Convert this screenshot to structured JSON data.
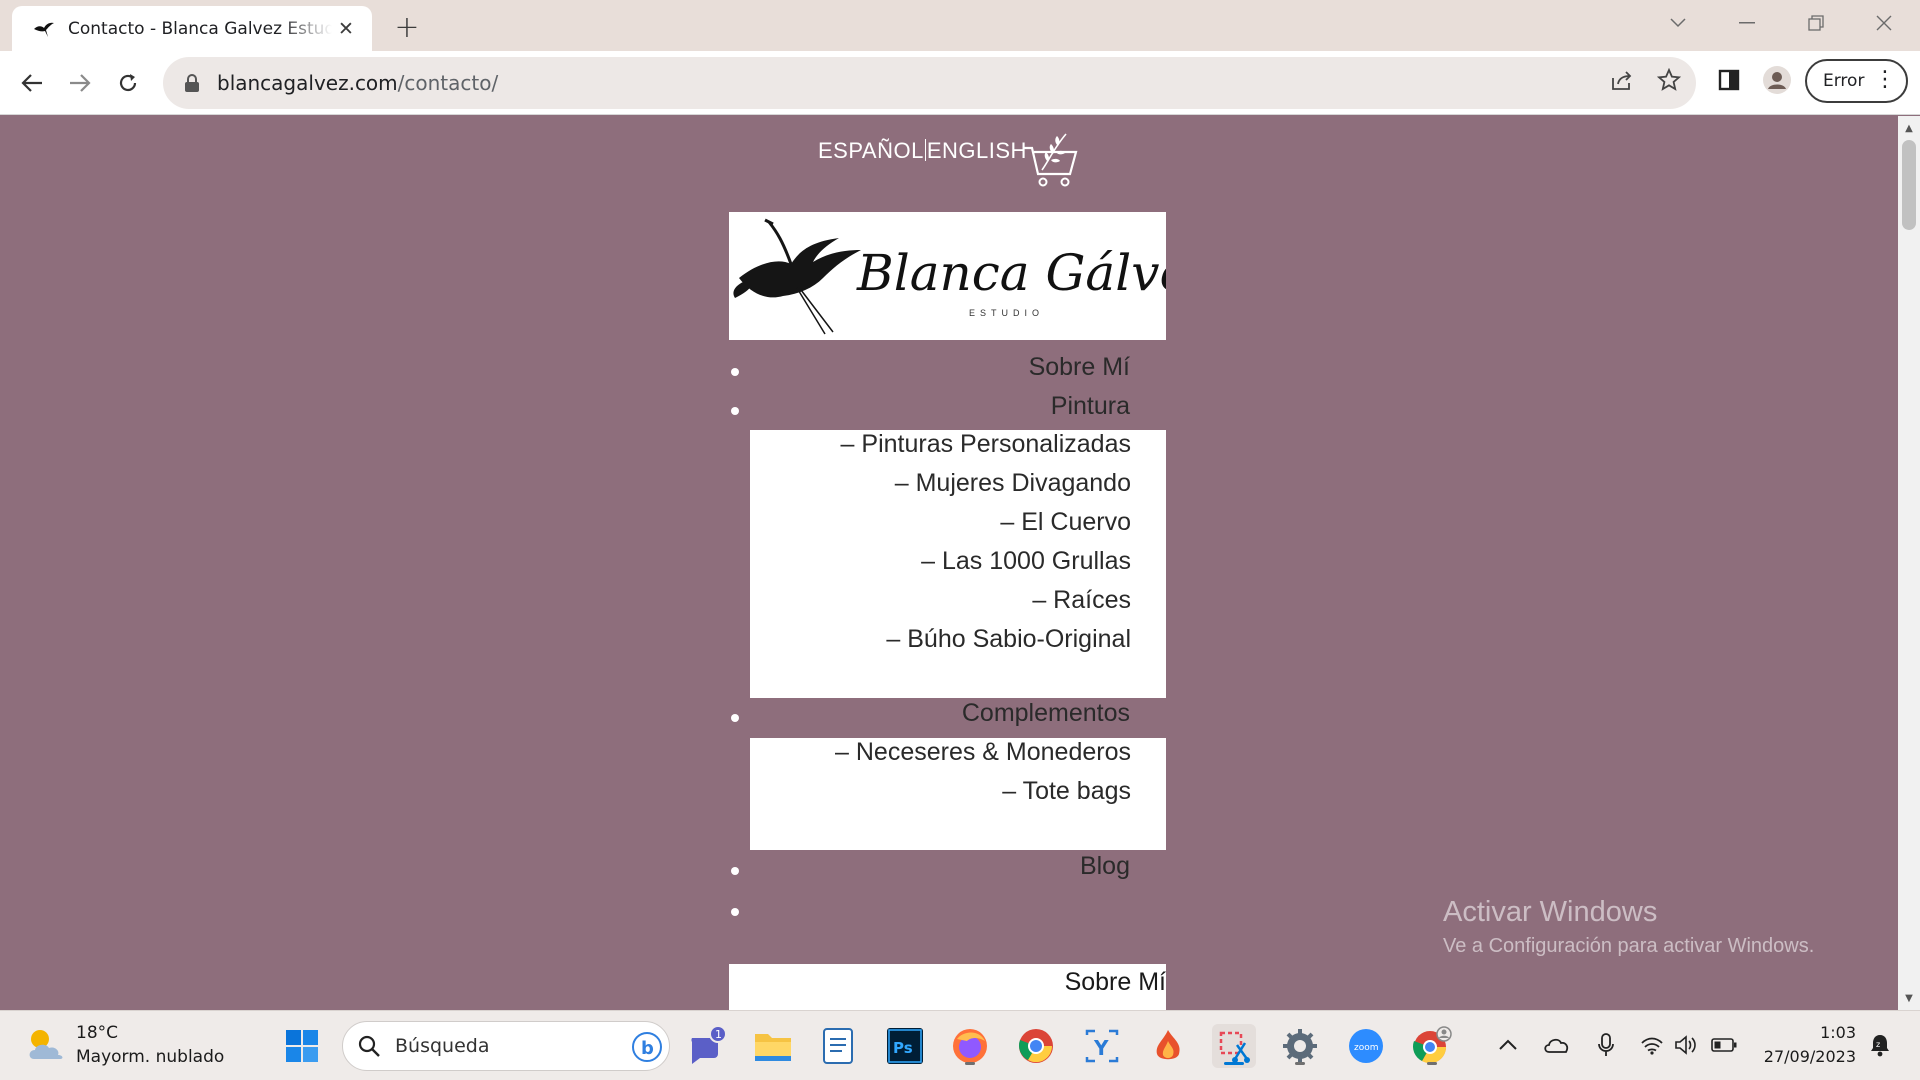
{
  "browser": {
    "tab_title": "Contacto - Blanca Galvez Estudio",
    "url_domain": "blancagalvez.com",
    "url_path": "/contacto/",
    "profile_label": "Error"
  },
  "page": {
    "lang_es": "ESPAÑOL",
    "lang_en": "ENGLISH",
    "logo_name": "Blanca Gálvez",
    "logo_sub": "ESTUDIO",
    "menu": {
      "sobre_mi": "Sobre Mí",
      "pintura": "Pintura",
      "pintura_items": [
        "– Pinturas Personalizadas",
        "– Mujeres Divagando",
        "– El Cuervo",
        "– Las 1000 Grullas",
        "– Raíces",
        "– Búho Sabio-Original"
      ],
      "complementos": "Complementos",
      "complementos_items": [
        "– Neceseres & Monederos",
        "– Tote bags"
      ],
      "blog": "Blog"
    },
    "second_menu_first": "Sobre Mí",
    "background_color": "#8e6e7c"
  },
  "watermark": {
    "title": "Activar Windows",
    "subtitle": "Ve a Configuración para activar Windows."
  },
  "taskbar": {
    "weather_temp": "18°C",
    "weather_desc": "Mayorm. nublado",
    "search_placeholder": "Búsqueda",
    "chat_badge": "1",
    "time": "1:03",
    "date": "27/09/2023"
  }
}
